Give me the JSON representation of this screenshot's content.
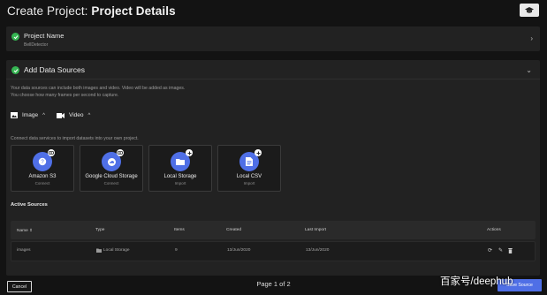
{
  "header": {
    "title_prefix": "Create Project:",
    "title_strong": "Project Details",
    "hat_icon": "graduation-cap-icon"
  },
  "project_name": {
    "label": "Project Name",
    "value": "BellDetector"
  },
  "data_sources": {
    "label": "Add Data Sources",
    "desc_line1": "Your data sources can include both images and video. Video will be added as images.",
    "desc_line2": "You choose how many frames per second to capture.",
    "media_image": "Image",
    "media_video": "Video",
    "connect_text": "Connect data services to import datasets into your own project.",
    "cards": [
      {
        "name": "Amazon S3",
        "sub": "Connect",
        "icon": "amazon-s3-icon"
      },
      {
        "name": "Google Cloud Storage",
        "sub": "Connect",
        "icon": "cloud-icon"
      },
      {
        "name": "Local Storage",
        "sub": "Import",
        "icon": "folder-icon"
      },
      {
        "name": "Local CSV",
        "sub": "Import",
        "icon": "file-icon"
      }
    ],
    "active_sources_title": "Active Sources",
    "table": {
      "headers": {
        "name": "Name",
        "type": "Type",
        "items": "Items",
        "created": "Created",
        "last_import": "Last Import",
        "actions": "Actions"
      },
      "rows": [
        {
          "name": "images",
          "type": "Local Storage",
          "items": "9",
          "created": "13/Jun/2020",
          "last_import": "13/Jun/2020"
        }
      ]
    }
  },
  "footer": {
    "cancel": "Cancel",
    "pager": "Page 1 of 2",
    "primary": "Save Source"
  },
  "watermark": "百家号/deephub",
  "colors": {
    "accent": "#4f6fe6",
    "success": "#35b552",
    "background": "#131313",
    "panel": "#222222"
  }
}
